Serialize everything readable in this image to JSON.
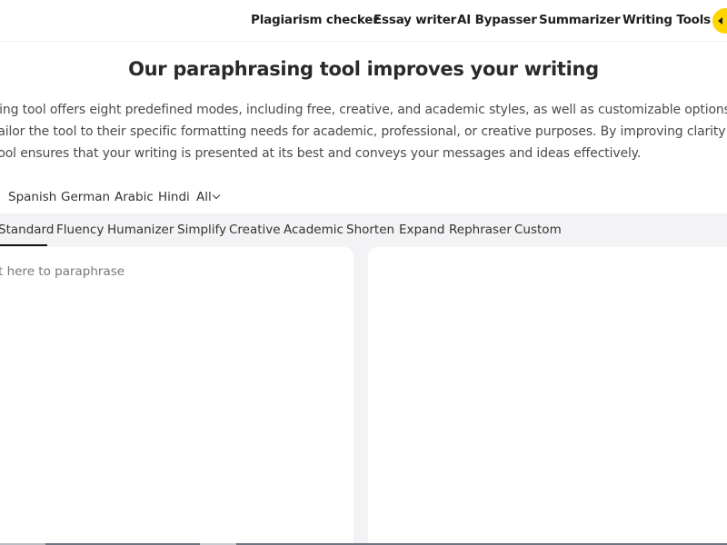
{
  "nav": {
    "items": [
      {
        "label": "Plagiarism checker"
      },
      {
        "label": "Essay writer"
      },
      {
        "label": "AI Bypasser"
      },
      {
        "label": "Summarizer"
      },
      {
        "label": "Writing Tools"
      }
    ],
    "cta_icon": "arrow-left-icon",
    "cta_color": "#ffd500"
  },
  "headline": "Our paraphrasing tool improves your writing",
  "intro": {
    "line1": "sing tool offers eight predefined modes, including free, creative, and academic styles, as well as customizable options. These t",
    "line2": " tailor the tool to their specific formatting needs for academic, professional, or creative purposes. By improving clarity and flo",
    "line3": "tool ensures that your writing is presented at its best and conveys your messages and ideas effectively."
  },
  "languages": {
    "items": [
      "Spanish",
      "German",
      "Arabic",
      "Hindi"
    ],
    "all_label": "All",
    "all_icon": "chevron-down-icon"
  },
  "modes": {
    "items": [
      "Standard",
      "Fluency",
      "Humanizer",
      "Simplify",
      "Creative",
      "Academic",
      "Shorten",
      "Expand",
      "Rephraser",
      "Custom"
    ],
    "active": "Standard"
  },
  "editor": {
    "input_placeholder": "xt here to paraphrase",
    "output_text": ""
  }
}
